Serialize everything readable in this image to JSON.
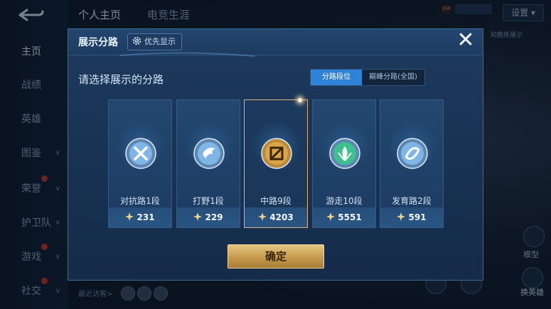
{
  "background": {
    "top_tabs": [
      "个人主页",
      "电竞生涯"
    ],
    "settings_label": "设置",
    "status_badge": "ESP",
    "status_text": "",
    "right_hint": "和教练展示",
    "sidebar": [
      {
        "label": "主页",
        "active": true,
        "chevron": false,
        "dot": false
      },
      {
        "label": "战绩",
        "active": false,
        "chevron": false,
        "dot": false
      },
      {
        "label": "英雄",
        "active": false,
        "chevron": false,
        "dot": false
      },
      {
        "label": "图鉴",
        "active": false,
        "chevron": true,
        "dot": false
      },
      {
        "label": "荣誉",
        "active": false,
        "chevron": true,
        "dot": true
      },
      {
        "label": "护卫队",
        "active": false,
        "chevron": true,
        "dot": false
      },
      {
        "label": "游戏",
        "active": false,
        "chevron": true,
        "dot": true
      },
      {
        "label": "社交",
        "active": false,
        "chevron": true,
        "dot": true
      }
    ],
    "recent_label": "最近访客>",
    "model_label": "模型",
    "switch_hero_label": "换英雄"
  },
  "modal": {
    "title": "展示分路",
    "priority_button": "优先显示",
    "prompt": "请选择展示的分路",
    "tabs": [
      {
        "label": "分路段位",
        "active": true
      },
      {
        "label": "巅峰分路(全国)",
        "active": false
      }
    ],
    "lanes": [
      {
        "name": "对抗路1段",
        "points": "231",
        "icon": "clash-lane-icon",
        "color": "#7fb6e6",
        "selected": false
      },
      {
        "name": "打野1段",
        "points": "229",
        "icon": "jungle-icon",
        "color": "#7fb6e6",
        "selected": false
      },
      {
        "name": "中路9段",
        "points": "4203",
        "icon": "mid-lane-icon",
        "color": "#d9a548",
        "selected": true
      },
      {
        "name": "游走10段",
        "points": "5551",
        "icon": "roam-icon",
        "color": "#3fbf8f",
        "selected": false
      },
      {
        "name": "发育路2段",
        "points": "591",
        "icon": "farm-lane-icon",
        "color": "#7fb6e6",
        "selected": false
      }
    ],
    "confirm_label": "确定",
    "close_label": "✕"
  },
  "colors": {
    "accent_blue": "#2f83d6",
    "gold": "#d9b27a",
    "confirm_gold": "#c69a4e"
  }
}
